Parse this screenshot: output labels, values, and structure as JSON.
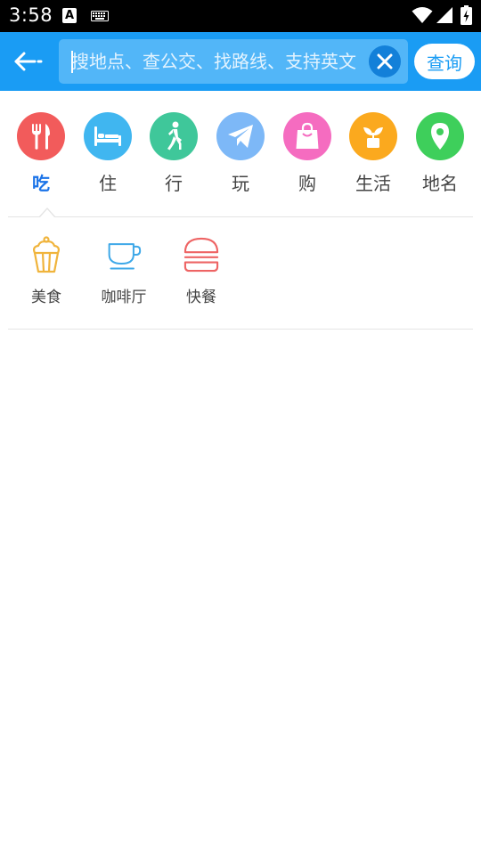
{
  "status_bar": {
    "time": "3:58",
    "a_badge": "A",
    "icons": [
      "a-notification-icon",
      "keyboard-icon",
      "wifi-icon",
      "signal-icon",
      "battery-icon"
    ]
  },
  "search": {
    "placeholder": "搜地点、查公交、找路线、支持英文",
    "value": "",
    "query_label": "查询",
    "colors": {
      "header": "#1a9cf4",
      "box": "#52b6f8",
      "clear": "#1380d9"
    }
  },
  "categories": [
    {
      "label": "吃",
      "icon": "fork-knife-icon",
      "color": "#f25b5b",
      "active": true
    },
    {
      "label": "住",
      "icon": "bed-icon",
      "color": "#40b6f0",
      "active": false
    },
    {
      "label": "行",
      "icon": "walking-person-icon",
      "color": "#3fc79a",
      "active": false
    },
    {
      "label": "玩",
      "icon": "paper-plane-icon",
      "color": "#7db8f7",
      "active": false
    },
    {
      "label": "购",
      "icon": "shopping-bag-icon",
      "color": "#f56cc0",
      "active": false
    },
    {
      "label": "生活",
      "icon": "sprout-icon",
      "color": "#fba91e",
      "active": false
    },
    {
      "label": "地名",
      "icon": "location-pin-icon",
      "color": "#3ecf5b",
      "active": false
    }
  ],
  "subcategories": [
    {
      "label": "美食",
      "icon": "cupcake-icon",
      "color": "#f0b43c"
    },
    {
      "label": "咖啡厅",
      "icon": "coffee-cup-icon",
      "color": "#3ea8e8"
    },
    {
      "label": "快餐",
      "icon": "burger-icon",
      "color": "#ee6464"
    }
  ]
}
